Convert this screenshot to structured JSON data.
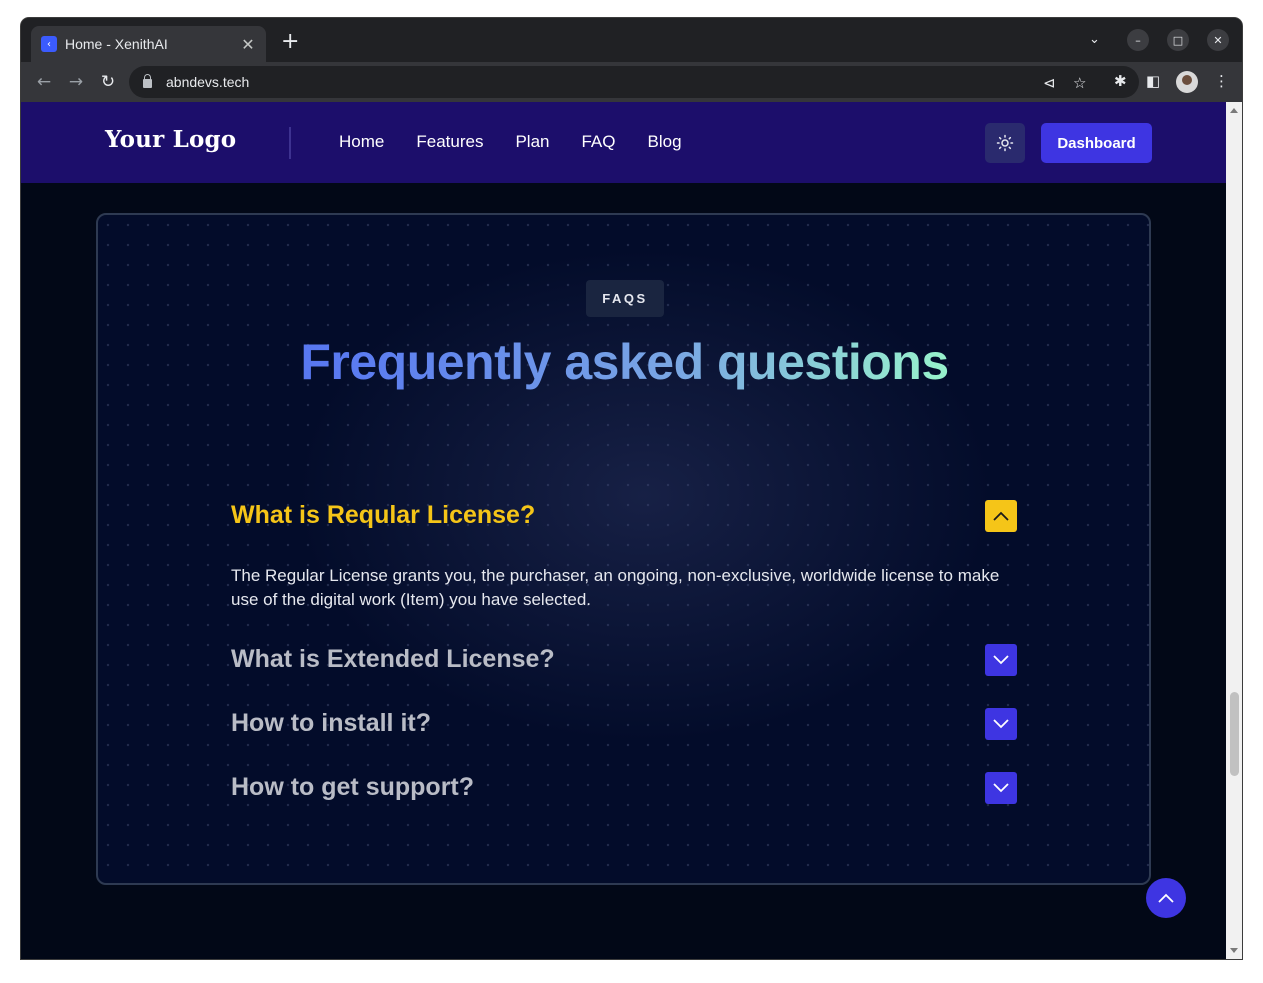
{
  "browser": {
    "tab_title": "Home - XenithAI",
    "url": "abndevs.tech",
    "favicon_color": "#3b5bfd"
  },
  "header": {
    "logo": "Your Logo",
    "nav": [
      "Home",
      "Features",
      "Plan",
      "FAQ",
      "Blog"
    ],
    "theme_icon": "sun-icon",
    "dashboard_label": "Dashboard",
    "background": "#1c0e6b",
    "accent": "#3e35e2"
  },
  "faq": {
    "badge": "FAQS",
    "title": "Frequently asked questions",
    "items": [
      {
        "question": "What is Reqular License?",
        "answer": "The Regular License grants you, the purchaser, an ongoing, non-exclusive, worldwide license to make use of the digital work (Item) you have selected.",
        "open": true
      },
      {
        "question": "What is Extended License?",
        "open": false
      },
      {
        "question": "How to install it?",
        "open": false
      },
      {
        "question": "How to get support?",
        "open": false
      }
    ],
    "open_color": "#f5c518",
    "closed_color": "#3e35e2"
  }
}
